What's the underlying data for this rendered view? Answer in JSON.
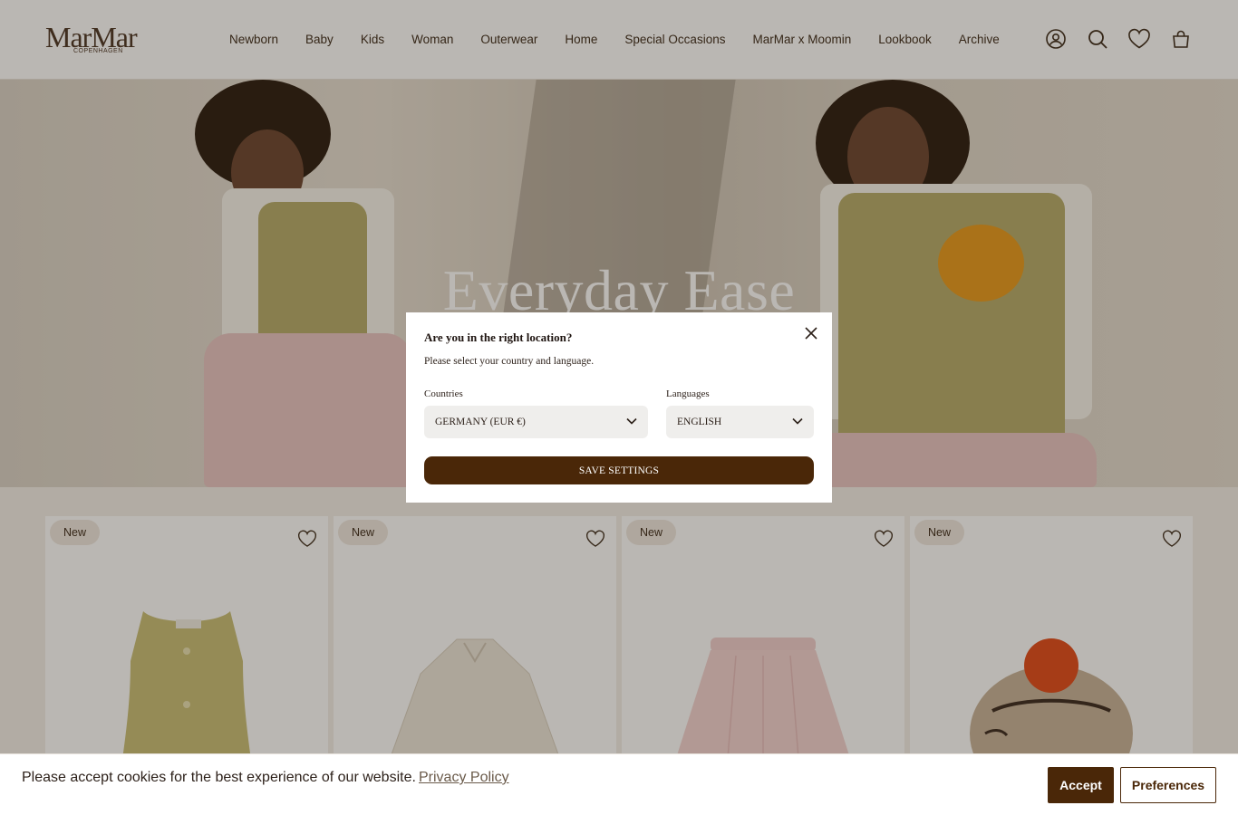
{
  "brand": {
    "name": "MarMar",
    "subtitle": "COPENHAGEN"
  },
  "nav": {
    "items": [
      {
        "label": "Newborn"
      },
      {
        "label": "Baby"
      },
      {
        "label": "Kids"
      },
      {
        "label": "Woman"
      },
      {
        "label": "Outerwear"
      },
      {
        "label": "Home"
      },
      {
        "label": "Special Occasions"
      },
      {
        "label": "MarMar x Moomin"
      },
      {
        "label": "Lookbook"
      },
      {
        "label": "Archive"
      }
    ]
  },
  "header_icons": [
    "account-icon",
    "search-icon",
    "wishlist-heart-icon",
    "cart-bag-icon"
  ],
  "hero": {
    "title": "Everyday Ease"
  },
  "products": [
    {
      "badge": "New",
      "item": "vest"
    },
    {
      "badge": "New",
      "item": "dress"
    },
    {
      "badge": "New",
      "item": "skirt"
    },
    {
      "badge": "New",
      "item": "beret"
    }
  ],
  "location_modal": {
    "title": "Are you in the right location?",
    "subtitle": "Please select your country and language.",
    "countries_label": "Countries",
    "country_value": "GERMANY (EUR €)",
    "languages_label": "Languages",
    "language_value": "ENGLISH",
    "save_label": "SAVE SETTINGS"
  },
  "cookie_bar": {
    "text": "Please accept cookies for the best experience of our website.",
    "link": "Privacy Policy",
    "accept_label": "Accept",
    "preferences_label": "Preferences"
  },
  "colors": {
    "brand_brown": "#4a2708",
    "text": "#3b2a1a",
    "badge_bg": "#efe8e0"
  }
}
